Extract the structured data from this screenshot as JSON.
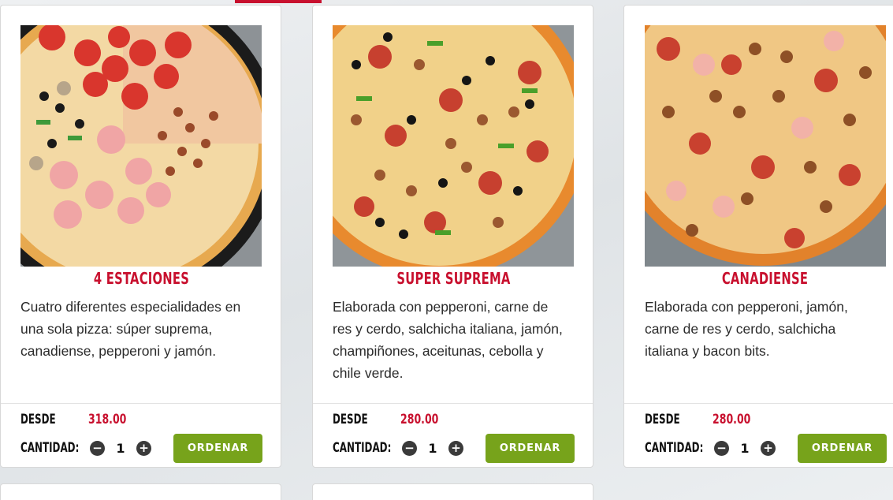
{
  "products": [
    {
      "title": "4 ESTACIONES",
      "description": "Cuatro diferentes especialidades en una sola pizza: súper suprema, canadiense, pepperoni y jamón.",
      "price_label": "DESDE",
      "price": "318.00",
      "qty_label": "CANTIDAD:",
      "qty": "1",
      "order_label": "ORDENAR"
    },
    {
      "title": "SUPER SUPREMA",
      "description": "Elaborada con pepperoni, carne de res y cerdo, salchicha italiana, jamón, champiñones, aceitunas, cebolla y chile verde.",
      "price_label": "DESDE",
      "price": "280.00",
      "qty_label": "CANTIDAD:",
      "qty": "1",
      "order_label": "ORDENAR"
    },
    {
      "title": "CANADIENSE",
      "description": "Elaborada con pepperoni, jamón, carne de res y cerdo, salchicha italiana y bacon bits.",
      "price_label": "DESDE",
      "price": "280.00",
      "qty_label": "CANTIDAD:",
      "qty": "1",
      "order_label": "ORDENAR"
    }
  ],
  "icons": {
    "minus": "minus-circle-icon",
    "plus": "plus-circle-icon"
  },
  "colors": {
    "brand_red": "#c8102e",
    "order_green": "#77a31b"
  }
}
